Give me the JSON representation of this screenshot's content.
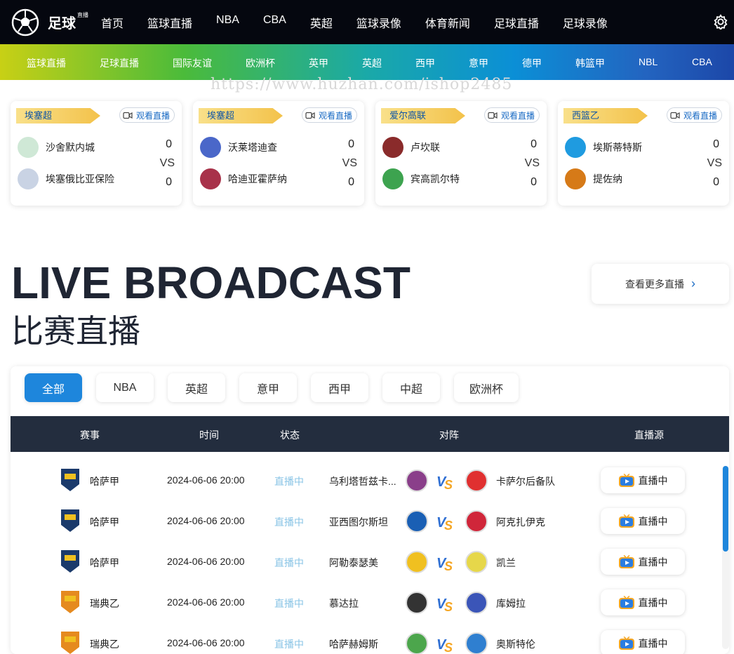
{
  "brand": {
    "name": "足球",
    "sup": "直播"
  },
  "main_nav": [
    "首页",
    "篮球直播",
    "NBA",
    "CBA",
    "英超",
    "篮球录像",
    "体育新闻",
    "足球直播",
    "足球录像"
  ],
  "cat_nav": [
    "篮球直播",
    "足球直播",
    "国际友谊",
    "欧洲杯",
    "英甲",
    "英超",
    "西甲",
    "意甲",
    "德甲",
    "韩篮甲",
    "NBL",
    "CBA"
  ],
  "watermark": "https://www.huzhan.com/ishop2485",
  "watch_label": "观看直播",
  "vs_label": "VS",
  "cards": [
    {
      "league": "埃塞超",
      "home": "沙舍默内城",
      "away": "埃塞俄比亚保险",
      "home_score": "0",
      "away_score": "0",
      "home_color": "#cfe8d6",
      "away_color": "#c9d3e4"
    },
    {
      "league": "埃塞超",
      "home": "沃莱塔迪查",
      "away": "哈迪亚霍萨纳",
      "home_score": "0",
      "away_score": "0",
      "home_color": "#4a67c9",
      "away_color": "#a8324a"
    },
    {
      "league": "爱尔高联",
      "home": "卢坎联",
      "away": "宾高凯尔特",
      "home_score": "0",
      "away_score": "0",
      "home_color": "#8a2b2b",
      "away_color": "#3da34f"
    },
    {
      "league": "西篮乙",
      "home": "埃斯蒂特斯",
      "away": "提佐纳",
      "home_score": "0",
      "away_score": "0",
      "home_color": "#1f9be0",
      "away_color": "#d67a18"
    }
  ],
  "hero": {
    "en": "LIVE BROADCAST",
    "cn": "比赛直播"
  },
  "more_label": "查看更多直播",
  "tabs": [
    "全部",
    "NBA",
    "英超",
    "意甲",
    "西甲",
    "中超",
    "欧洲杯"
  ],
  "columns": [
    "赛事",
    "时间",
    "状态",
    "对阵",
    "直播源"
  ],
  "live_btn": "直播中",
  "rows": [
    {
      "league": "哈萨甲",
      "time": "2024-06-06 20:00",
      "status": "直播中",
      "home": "乌利塔哲兹卡...",
      "away": "卡萨尔后备队",
      "lg_color": "#1b3a6b",
      "hb_color": "#8a3f8a",
      "ab_color": "#e03030"
    },
    {
      "league": "哈萨甲",
      "time": "2024-06-06 20:00",
      "status": "直播中",
      "home": "亚西图尔斯坦",
      "away": "阿克扎伊克",
      "lg_color": "#1b3a6b",
      "hb_color": "#1a5fb4",
      "ab_color": "#d0263a"
    },
    {
      "league": "哈萨甲",
      "time": "2024-06-06 20:00",
      "status": "直播中",
      "home": "阿勒泰瑟美",
      "away": "凯兰",
      "lg_color": "#1b3a6b",
      "hb_color": "#f0c020",
      "ab_color": "#e6d74a"
    },
    {
      "league": "瑞典乙",
      "time": "2024-06-06 20:00",
      "status": "直播中",
      "home": "慕达拉",
      "away": "库姆拉",
      "lg_color": "#e58a1f",
      "hb_color": "#333333",
      "ab_color": "#3b55b8"
    },
    {
      "league": "瑞典乙",
      "time": "2024-06-06 20:00",
      "status": "直播中",
      "home": "哈萨赫姆斯",
      "away": "奥斯特伦",
      "lg_color": "#e58a1f",
      "hb_color": "#4ca64c",
      "ab_color": "#2f7fd0"
    }
  ]
}
